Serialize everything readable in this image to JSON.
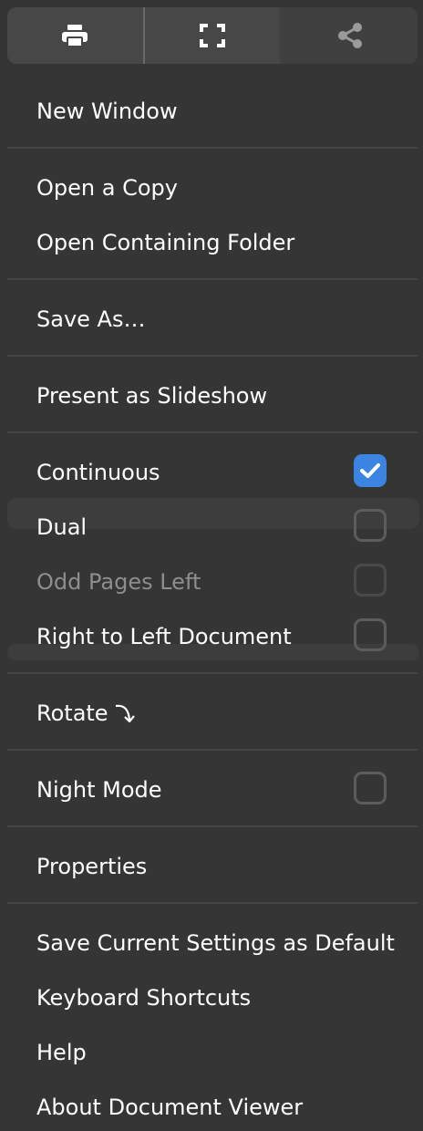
{
  "toolbar": {
    "buttons": [
      {
        "icon": "printer-icon"
      },
      {
        "icon": "fullscreen-icon"
      },
      {
        "icon": "share-icon"
      }
    ]
  },
  "menu": {
    "new_window": "New Window",
    "open_copy": "Open a Copy",
    "open_folder": "Open Containing Folder",
    "save_as": "Save As…",
    "present": "Present as Slideshow",
    "continuous": {
      "label": "Continuous",
      "checked": true
    },
    "dual": {
      "label": "Dual",
      "checked": false
    },
    "odd_pages_left": {
      "label": "Odd Pages Left",
      "checked": false,
      "disabled": true
    },
    "rtl": {
      "label": "Right to Left Document",
      "checked": false
    },
    "rotate": "Rotate",
    "night_mode": {
      "label": "Night Mode",
      "checked": false
    },
    "properties": "Properties",
    "save_defaults": "Save Current Settings as Default",
    "shortcuts": "Keyboard Shortcuts",
    "help": "Help",
    "about": "About Document Viewer"
  },
  "colors": {
    "background": "#353535",
    "accent": "#3b84e1",
    "text": "#ffffff",
    "disabled_text": "#8e8e8e"
  }
}
